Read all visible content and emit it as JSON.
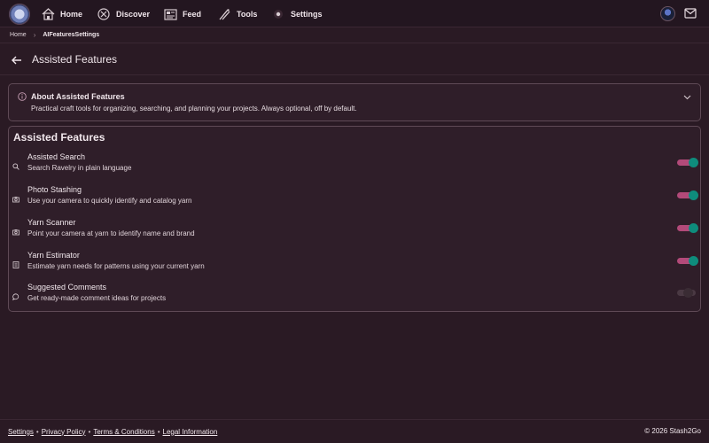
{
  "nav": {
    "items": [
      {
        "label": "Home",
        "icon": "home-icon"
      },
      {
        "label": "Discover",
        "icon": "compass-icon"
      },
      {
        "label": "Feed",
        "icon": "feed-icon"
      },
      {
        "label": "Tools",
        "icon": "tools-icon"
      },
      {
        "label": "Settings",
        "icon": "settings-icon"
      }
    ]
  },
  "breadcrumb": {
    "home": "Home",
    "separator": "›",
    "current": "AIFeaturesSettings"
  },
  "page": {
    "title": "Assisted Features"
  },
  "about": {
    "title": "About Assisted Features",
    "description": "Practical craft tools for organizing, searching, and planning your projects. Always optional, off by default."
  },
  "features": {
    "heading": "Assisted Features",
    "items": [
      {
        "title": "Assisted Search",
        "description": "Search Ravelry in plain language",
        "icon": "search-icon",
        "enabled": true
      },
      {
        "title": "Photo Stashing",
        "description": "Use your camera to quickly identify and catalog yarn",
        "icon": "camera-icon",
        "enabled": true
      },
      {
        "title": "Yarn Scanner",
        "description": "Point your camera at yarn to identify name and brand",
        "icon": "scan-icon",
        "enabled": true
      },
      {
        "title": "Yarn Estimator",
        "description": "Estimate yarn needs for patterns using your current yarn",
        "icon": "calculator-icon",
        "enabled": true
      },
      {
        "title": "Suggested Comments",
        "description": "Get ready-made comment ideas for projects",
        "icon": "comment-icon",
        "enabled": false
      }
    ]
  },
  "footer": {
    "links": [
      "Settings",
      "Privacy Policy",
      "Terms & Conditions",
      "Legal Information"
    ],
    "separator": "•",
    "copyright": "© 2026 Stash2Go"
  },
  "colors": {
    "background": "#2a1a24",
    "toggle_on_track": "#b24a79",
    "toggle_on_knob": "#0e8c7c",
    "card_border": "#5f4a56"
  }
}
